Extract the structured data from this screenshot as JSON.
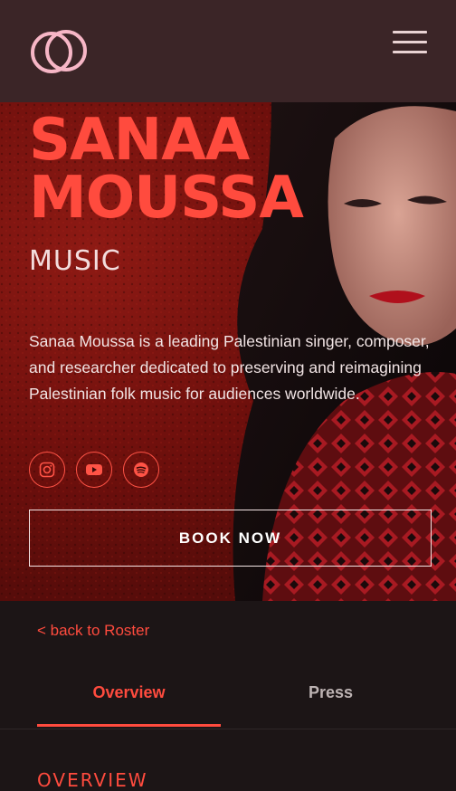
{
  "header": {
    "logo_icon": "interlocking-circles-logo",
    "menu_icon": "hamburger-menu-icon"
  },
  "hero": {
    "name_line1": "SANAA",
    "name_line2": "MOUSSA",
    "subtitle": "MUSIC",
    "bio": "Sanaa Moussa is a leading Palestinian singer, composer, and researcher dedicated to preserving and reimagining Palestinian folk music for audiences worldwide.",
    "socials": [
      {
        "icon": "instagram-icon"
      },
      {
        "icon": "youtube-icon"
      },
      {
        "icon": "spotify-icon"
      }
    ],
    "book_label": "BOOK NOW"
  },
  "nav": {
    "back_link": "< back to Roster"
  },
  "tabs": [
    {
      "label": "Overview",
      "active": true
    },
    {
      "label": "Press",
      "active": false
    }
  ],
  "section_title": "OVERVIEW",
  "colors": {
    "accent": "#ff4b3e",
    "header_bg": "#3b2527",
    "page_bg": "#1c1516"
  }
}
